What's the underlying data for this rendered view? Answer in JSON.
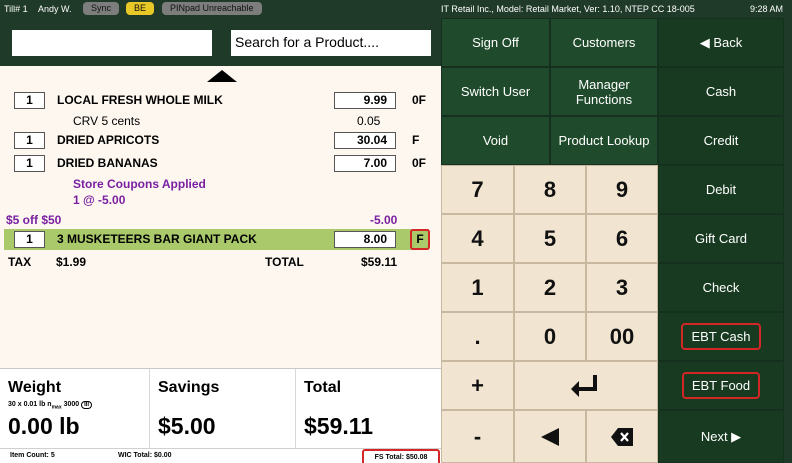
{
  "topbar": {
    "till": "Till# 1",
    "user": "Andy W.",
    "sync": "Sync",
    "be": "BE",
    "pinpad": "PINpad Unreachable",
    "model": "IT Retail Inc., Model: Retail Market, Ver: 1.10, NTEP CC 18-005",
    "time": "9:28 AM"
  },
  "search": {
    "scan_value": "",
    "product_placeholder": "Search for a Product...."
  },
  "sale": {
    "items": [
      {
        "qty": "1",
        "name": "LOCAL FRESH WHOLE MILK",
        "price": "9.99",
        "flag": "0F"
      },
      {
        "qty": "1",
        "name": "DRIED APRICOTS",
        "price": "30.04",
        "flag": "F"
      },
      {
        "qty": "1",
        "name": "DRIED BANANAS",
        "price": "7.00",
        "flag": "0F"
      },
      {
        "qty": "1",
        "name": "3 MUSKETEERS BAR GIANT PACK",
        "price": "8.00",
        "flag": "F"
      }
    ],
    "crv_label": "CRV 5 cents",
    "crv_value": "0.05",
    "coupons_label": "Store Coupons Applied",
    "coupon_detail": "1 @ -5.00",
    "discount_label": "$5 off $50",
    "discount_value": "-5.00",
    "tax_label": "TAX",
    "tax_value": "$1.99",
    "total_label": "TOTAL",
    "total_value": "$59.11"
  },
  "totals": {
    "weight_label": "Weight",
    "weight_scale": "30 x 0.01 lb n",
    "weight_max_sub": "max",
    "weight_max": "3000",
    "weight_class": "III",
    "weight_value": "0.00 lb",
    "savings_label": "Savings",
    "savings_value": "$5.00",
    "total_label": "Total",
    "total_value": "$59.11"
  },
  "footer": {
    "item_count": "Item Count: 5",
    "wic_total": "WIC Total: $0.00",
    "fs_total": "FS Total: $50.08"
  },
  "keys": {
    "sign_off": "Sign Off",
    "customers": "Customers",
    "back": "◀ Back",
    "switch_user": "Switch User",
    "manager": "Manager Functions",
    "cash": "Cash",
    "void": "Void",
    "product_lookup": "Product Lookup",
    "credit": "Credit",
    "debit": "Debit",
    "gift_card": "Gift Card",
    "check": "Check",
    "ebt_cash": "EBT Cash",
    "ebt_food": "EBT Food",
    "next": "Next ▶",
    "n7": "7",
    "n8": "8",
    "n9": "9",
    "n4": "4",
    "n5": "5",
    "n6": "6",
    "n1": "1",
    "n2": "2",
    "n3": "3",
    "dot": ".",
    "n0": "0",
    "n00": "00",
    "plus": "+",
    "minus": "-"
  },
  "colors": {
    "bar_green": "#1f3a28",
    "key_green": "#1f4a2b",
    "keypad_beige": "#f1e4d0",
    "highlight_row": "#a9c96b",
    "coupon_purple": "#7b1fa2",
    "callout_red": "#d32626"
  }
}
